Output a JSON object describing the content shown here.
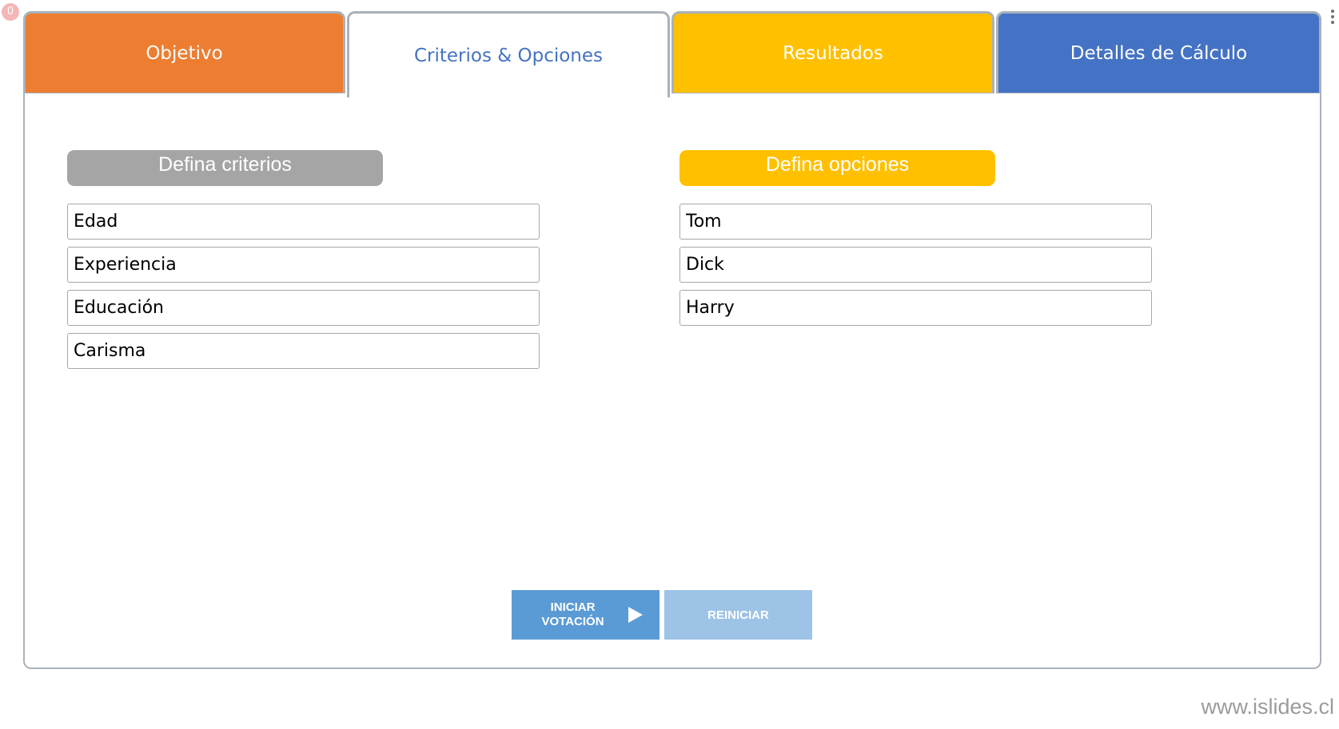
{
  "badge": {
    "count": "0"
  },
  "colors": {
    "objetivo": "#ed7d31",
    "criterios": "#ffffff",
    "resultados": "#ffc000",
    "detalles": "#4472c4",
    "header_criteria": "#a5a5a5",
    "header_options": "#ffc000",
    "start_button": "#5b9bd5",
    "reset_button": "#9dc3e6"
  },
  "tabs": [
    {
      "label": "Objetivo"
    },
    {
      "label": "Criterios & Opciones"
    },
    {
      "label": "Resultados"
    },
    {
      "label": "Detalles de Cálculo"
    }
  ],
  "criteria": {
    "header": "Defina criterios",
    "items": [
      "Edad",
      "Experiencia",
      "Educación",
      "Carisma"
    ]
  },
  "options": {
    "header": "Defina opciones",
    "items": [
      "Tom",
      "Dick",
      "Harry"
    ]
  },
  "buttons": {
    "start_line1": "INICIAR",
    "start_line2": "VOTACIÓN",
    "reset": "REINICIAR"
  },
  "footer": {
    "watermark": "www.islides.cl"
  }
}
